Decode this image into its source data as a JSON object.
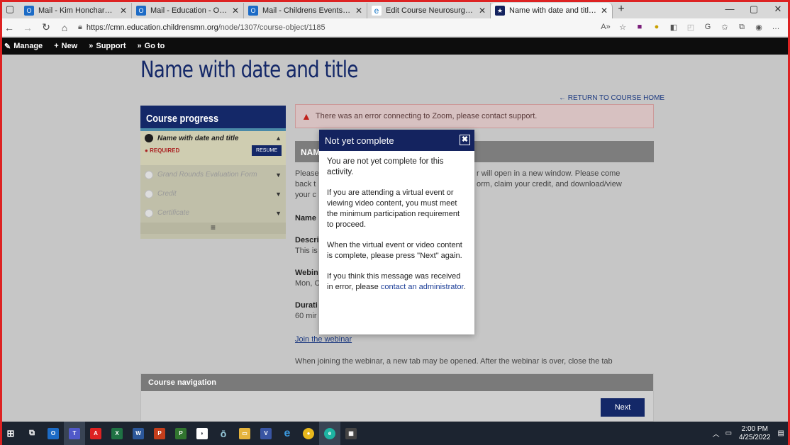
{
  "browser": {
    "tabs": [
      {
        "title": "Mail - Kim Honcharenko - Outlo",
        "favicon_color": "#1c6bc6",
        "favicon_glyph": "O"
      },
      {
        "title": "Mail - Education - Outlook",
        "favicon_color": "#1c6bc6",
        "favicon_glyph": "O"
      },
      {
        "title": "Mail - Childrens Events - Outloo",
        "favicon_color": "#1c6bc6",
        "favicon_glyph": "O"
      },
      {
        "title": "Edit Course Neurosurgical Interv",
        "favicon_color": "#e6e6e6",
        "favicon_glyph": "edge"
      },
      {
        "title": "Name with date and title | Childr",
        "favicon_color": "#14235f",
        "favicon_glyph": "★",
        "active": true
      }
    ],
    "url_host": "https://cmn.education.childrensmn.org",
    "url_path": "/node/1307/course-object/1185"
  },
  "admin_toolbar": {
    "manage": "Manage",
    "new": "New",
    "support": "Support",
    "goto": "Go to"
  },
  "page": {
    "title": "Name with date and title",
    "return_link": "← RETURN TO COURSE HOME",
    "alert": "There was an error connecting to Zoom, please contact support.",
    "activity_header": "NAME",
    "progress": {
      "heading": "Course progress",
      "current_step": "Name with date and title",
      "required": "REQUIRED",
      "resume": "RESUME",
      "steps": [
        "Grand Rounds Evaluation Form",
        "Credit",
        "Certificate"
      ]
    },
    "body": {
      "para1_a": "Please",
      "para1_b": "r will open in a new window. Please come",
      "para2_a": "back t",
      "para2_b": "orm, claim your credit, and download/view",
      "para3": "your c",
      "name_label": "Name",
      "desc_label": "Descri",
      "desc_value": "This is",
      "webinar_label": "Webin",
      "webinar_value": "Mon, C",
      "duration_label": "Durati",
      "duration_value": "60 mir",
      "join_link": "Join the webinar",
      "join_note": "When joining the webinar, a new tab may be opened. After the webinar is over, close the tab"
    },
    "course_nav": {
      "heading": "Course navigation",
      "next": "Next"
    }
  },
  "modal": {
    "title": "Not yet complete",
    "close": "✖",
    "p1": "You are not yet complete for this activity.",
    "p2": "If you are attending a virtual event or viewing video content, you must meet the minimum participation requirement to proceed.",
    "p3": "When the virtual event or video content is complete, please press \"Next\" again.",
    "p4_prefix": "If you think this message was received in error, please ",
    "p4_link": "contact an administrator",
    "p4_suffix": "."
  },
  "taskbar": {
    "time": "2:00 PM",
    "date": "4/25/2022"
  }
}
